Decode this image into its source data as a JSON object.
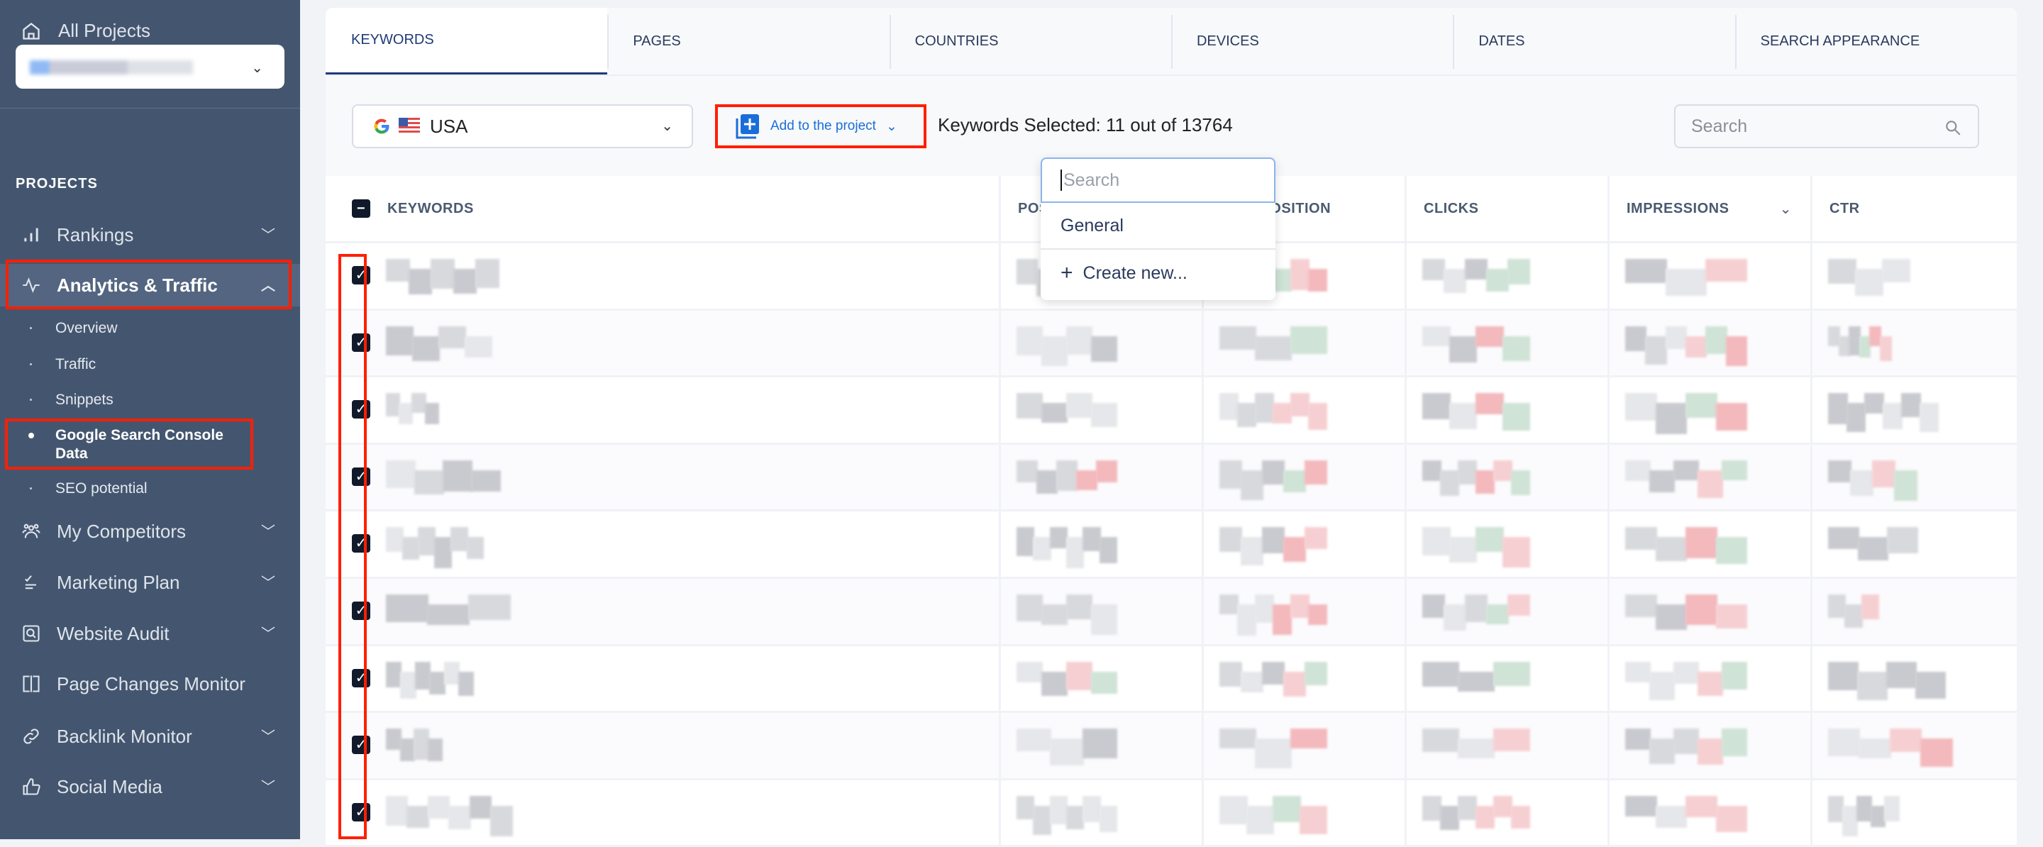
{
  "sidebar": {
    "all_projects": "All Projects",
    "section_label": "PROJECTS",
    "items": [
      {
        "label": "Rankings",
        "icon": "bar-chart-icon",
        "chevron": "down"
      },
      {
        "label": "Analytics & Traffic",
        "icon": "pulse-icon",
        "chevron": "up",
        "active": true
      },
      {
        "label": "My Competitors",
        "icon": "users-icon",
        "chevron": "down"
      },
      {
        "label": "Marketing Plan",
        "icon": "checklist-icon",
        "chevron": "down"
      },
      {
        "label": "Website Audit",
        "icon": "audit-search-icon",
        "chevron": "down"
      },
      {
        "label": "Page Changes Monitor",
        "icon": "page-compare-icon"
      },
      {
        "label": "Backlink Monitor",
        "icon": "link-icon",
        "chevron": "down"
      },
      {
        "label": "Social Media",
        "icon": "thumbs-up-icon",
        "chevron": "down"
      }
    ],
    "subitems": [
      "Overview",
      "Traffic",
      "Snippets",
      "Google Search Console Data",
      "SEO potential"
    ],
    "active_subitem": "Google Search Console Data"
  },
  "tabs": [
    "KEYWORDS",
    "PAGES",
    "COUNTRIES",
    "DEVICES",
    "DATES",
    "SEARCH APPEARANCE"
  ],
  "active_tab": "KEYWORDS",
  "toolbar": {
    "country": "USA",
    "add_to_project": "Add to the project",
    "keywords_selected": "Keywords Selected: 11 out of 13764",
    "search_placeholder": "Search"
  },
  "dropdown": {
    "search_placeholder": "Search",
    "items": [
      "General",
      "Create new..."
    ]
  },
  "table": {
    "columns": [
      "KEYWORDS",
      "POSITION",
      "AVG. POSITION",
      "CLICKS",
      "IMPRESSIONS",
      "CTR"
    ],
    "sorted_column": "IMPRESSIONS",
    "header_checkbox": "indeterminate",
    "rows_checked": [
      true,
      true,
      true,
      true,
      true,
      true,
      true,
      true,
      true
    ]
  },
  "colors": {
    "sidebar": "#44566f",
    "highlight": "#ff1f00",
    "accent": "#1a6ed8"
  }
}
